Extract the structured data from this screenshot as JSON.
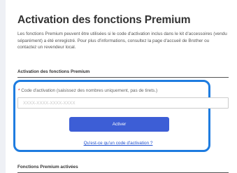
{
  "page": {
    "title": "Activation des fonctions Premium",
    "intro": "Les fonctions Premium peuvent être utilisées si le code d'activation inclus dans le kit d'accessoires (vendu séparément) a été enregistré. Pour plus d'informations, consultez la page d'accueil de Brother ou contactez un revendeur local."
  },
  "activation_section": {
    "heading": "Activation des fonctions Premium",
    "field_required_marker": "*",
    "field_label": "Code d'activation (saisissez des nombres uniquement, pas de tirets.)",
    "field_value": "",
    "field_placeholder": "XXXX-XXXX-XXXX-XXXX",
    "activate_button": "Activer",
    "help_link": "Qu'est-ce qu'un code d'activation ?"
  },
  "activated_section": {
    "heading": "Fonctions Premium activées"
  },
  "colors": {
    "highlight": "#1e7ce0",
    "button": "#3d5ed6",
    "link": "#1d4fcf"
  }
}
